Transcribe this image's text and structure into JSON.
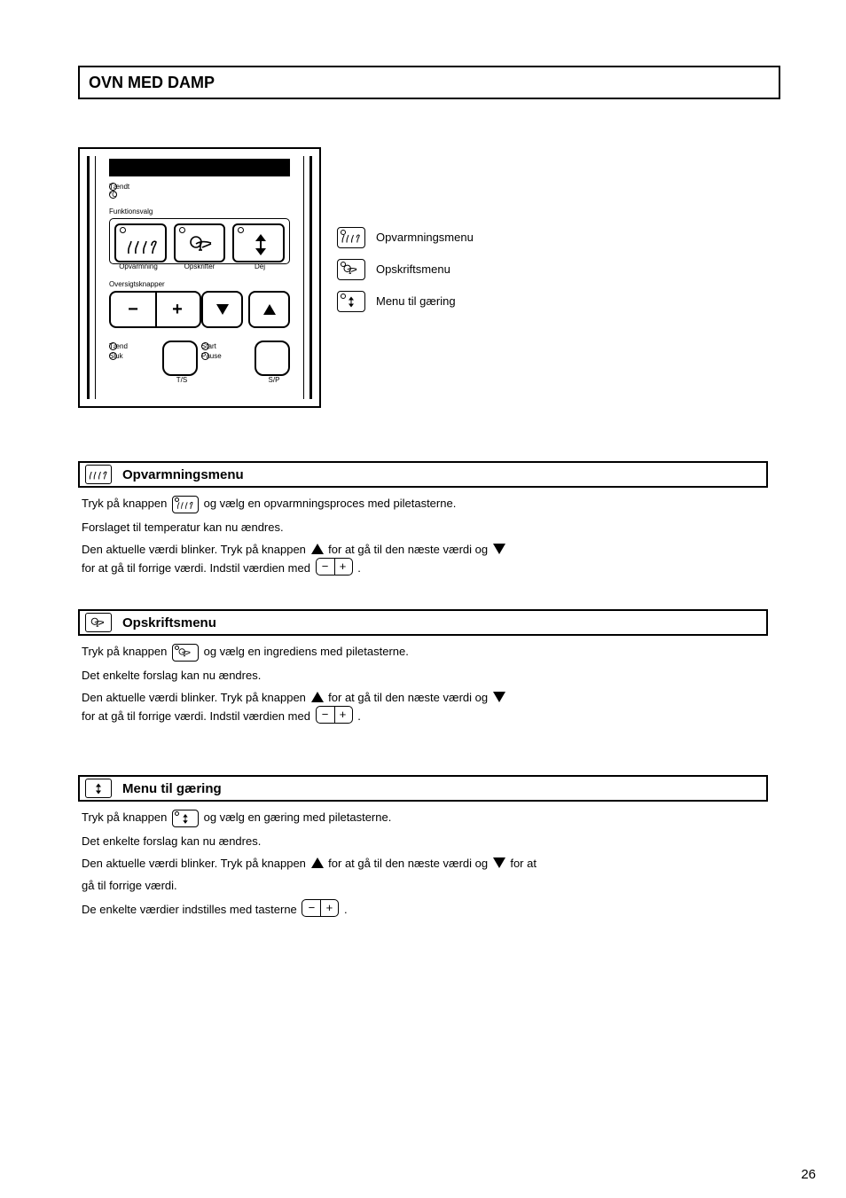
{
  "page": {
    "title": "OVN MED DAMP",
    "number": "26"
  },
  "panel": {
    "top_leds": {
      "label1": "Tændt",
      "label2": "°C"
    },
    "sel_group_label": "Funktionsvalg",
    "sel_btn1": "Opvarmning",
    "sel_btn2": "Opskrifter",
    "sel_btn3": "Dej",
    "adjust_label": "Oversigtsknapper",
    "bottom_left": {
      "label1": "Tænd",
      "label2": "Sluk",
      "btn": "T/S"
    },
    "bottom_right": {
      "label1": "Start",
      "label2": "Pause",
      "btn": "S/P"
    }
  },
  "legend": {
    "a": "Opvarmningsmenu",
    "b": "Opskriftsmenu",
    "c": "Menu til gæring"
  },
  "sections": {
    "heating": {
      "title": "Opvarmningsmenu",
      "p1a": "Tryk på knappen ",
      "p1b": " og vælg en opvarmningsproces med piletasterne.",
      "p2": "Forslaget til temperatur kan nu ændres.",
      "p3a": "Den aktuelle værdi blinker. Tryk på knappen ",
      "p3b": " for at gå til den næste værdi og",
      "p3c": "for at gå til forrige værdi. Indstil værdien med ",
      "p3d": "."
    },
    "recipes": {
      "title": "Opskriftsmenu",
      "p1a": "Tryk på knappen ",
      "p1b": " og vælg en ingrediens med piletasterne.",
      "p2": "Det enkelte forslag kan nu ændres.",
      "p3a": "Den aktuelle værdi blinker. Tryk på knappen ",
      "p3b": " for at gå til den næste værdi og",
      "p3c": "for at gå til forrige værdi. Indstil værdien med ",
      "p3d": "."
    },
    "rising": {
      "title": "Menu til gæring",
      "p1a": "Tryk på knappen ",
      "p1b": " og vælg en gæring med piletasterne.",
      "p2": "Det enkelte forslag kan nu ændres.",
      "p3a": "Den aktuelle værdi blinker. Tryk på knappen ",
      "p3b": " for at gå til den næste værdi og ",
      "p3c": " for at",
      "p4": "gå til forrige værdi.",
      "p5a": "De enkelte værdier indstilles med tasterne ",
      "p5b": "."
    }
  }
}
